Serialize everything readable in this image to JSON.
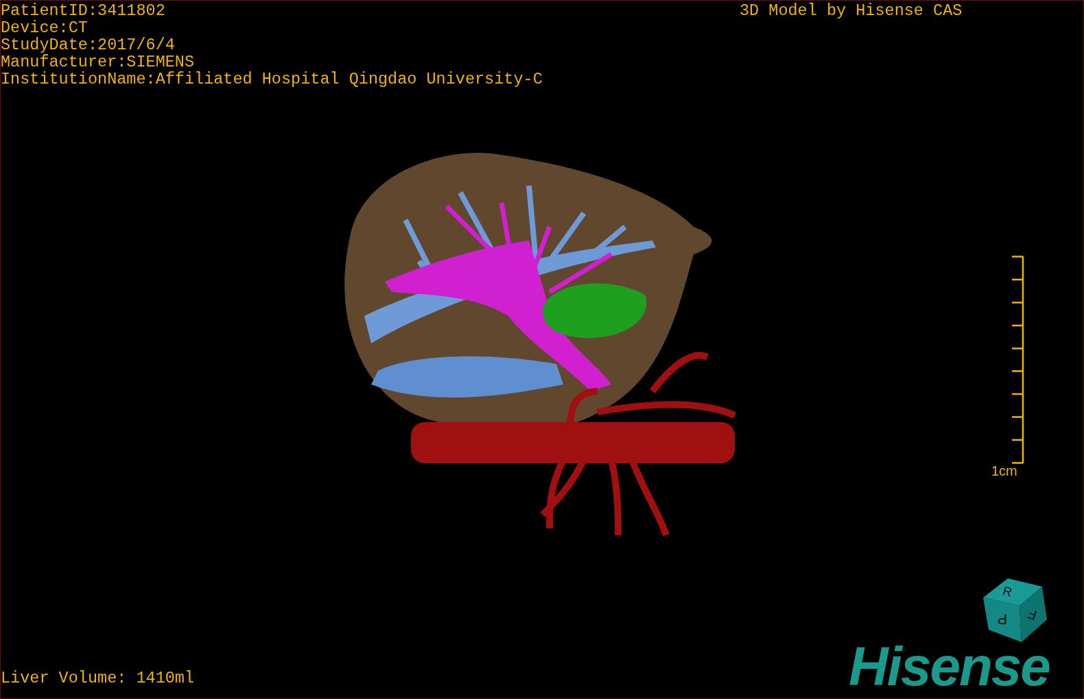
{
  "patient_info": [
    "PatientID:3411802",
    "Device:CT",
    "StudyDate:2017/6/4",
    "Manufacturer:SIEMENS",
    "InstitutionName:Affiliated Hospital Qingdao University-C"
  ],
  "title": "3D Model by Hisense CAS",
  "scale_bar": {
    "label": "1cm"
  },
  "orientation_cube": {
    "faces": [
      "R",
      "P",
      "F"
    ]
  },
  "liver_volume": "Liver Volume: 1410ml",
  "logo": "Hisense"
}
